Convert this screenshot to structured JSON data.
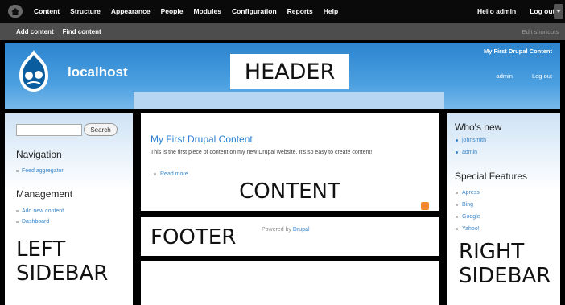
{
  "toolbar": {
    "menu": [
      "Content",
      "Structure",
      "Appearance",
      "People",
      "Modules",
      "Configuration",
      "Reports",
      "Help"
    ],
    "hello": "Hello admin",
    "logout": "Log out"
  },
  "shortcuts": {
    "links": [
      "Add content",
      "Find content"
    ],
    "edit": "Edit shortcuts"
  },
  "header": {
    "site_name": "localhost",
    "slogan": "My First Drupal Content",
    "secondary_nav": [
      "admin",
      "Log out"
    ],
    "region_label": "HEADER"
  },
  "left_sidebar": {
    "search_button": "Search",
    "navigation_title": "Navigation",
    "navigation_items": [
      "Feed aggregator"
    ],
    "management_title": "Management",
    "management_items": [
      "Add new content",
      "Dashboard"
    ],
    "region_label_1": "LEFT",
    "region_label_2": "SIDEBAR"
  },
  "content": {
    "title": "My First Drupal Content",
    "body": "This is the first piece of content on my new Drupal website. It's so easy to create content!",
    "read_more": "Read more",
    "region_label": "CONTENT"
  },
  "footer": {
    "powered_prefix": "Powered by",
    "powered_link": "Drupal",
    "region_label": "FOOTER"
  },
  "right_sidebar": {
    "whos_new_title": "Who's new",
    "whos_new_items": [
      "johnsmith",
      "admin"
    ],
    "special_title": "Special Features",
    "special_items": [
      "Apress",
      "Bing",
      "Google",
      "Yahoo!"
    ],
    "region_label_1": "RIGHT",
    "region_label_2": "SIDEBAR"
  },
  "colors": {
    "header_blue": "#2d85cf",
    "link_blue": "#3b86c9",
    "toolbar": "#0a0a0a",
    "shortcuts": "#4d4d4d",
    "rss_orange": "#f08a24"
  },
  "icons": [
    "home-icon",
    "drupal-logo-icon",
    "rss-feed-icon",
    "toolbar-toggle-icon"
  ]
}
